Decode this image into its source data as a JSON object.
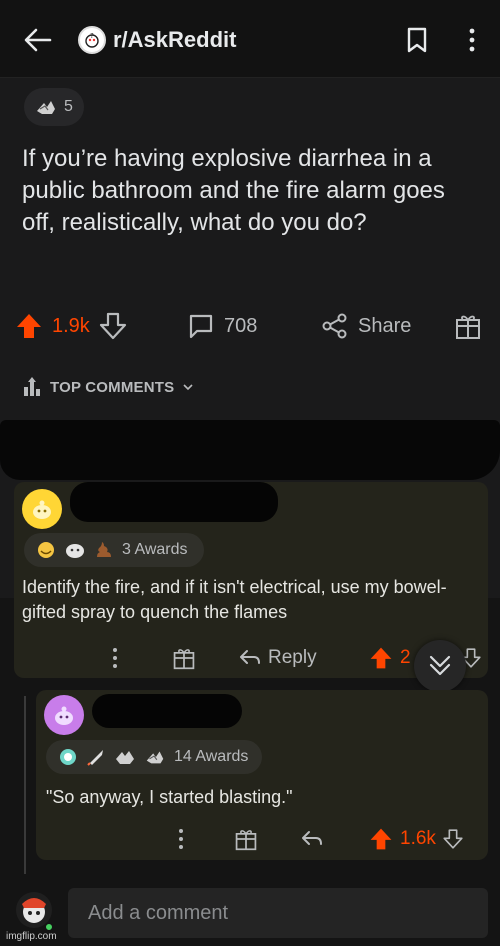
{
  "header": {
    "subreddit": "r/AskReddit"
  },
  "post": {
    "award_count": "5",
    "title": "If you’re having explosive diarrhea in a public bathroom and the fire alarm goes off, realistically, what do you do?",
    "upvotes": "1.9k",
    "comments": "708",
    "share_label": "Share"
  },
  "sort": {
    "label": "TOP COMMENTS"
  },
  "comments": [
    {
      "awards_label": "3 Awards",
      "body": "Identify the fire, and if it isn't electrical, use my bowel-gifted spray to quench the flames",
      "reply_label": "Reply",
      "score": "2"
    },
    {
      "awards_label": "14 Awards",
      "body": "\"So anyway, I started blasting.\"",
      "score": "1.6k"
    }
  ],
  "composer": {
    "placeholder": "Add a comment"
  },
  "watermark": "imgflip.com",
  "colors": {
    "upvote": "#ff4500",
    "background": "#141414",
    "comment_bg": "#24241b"
  }
}
